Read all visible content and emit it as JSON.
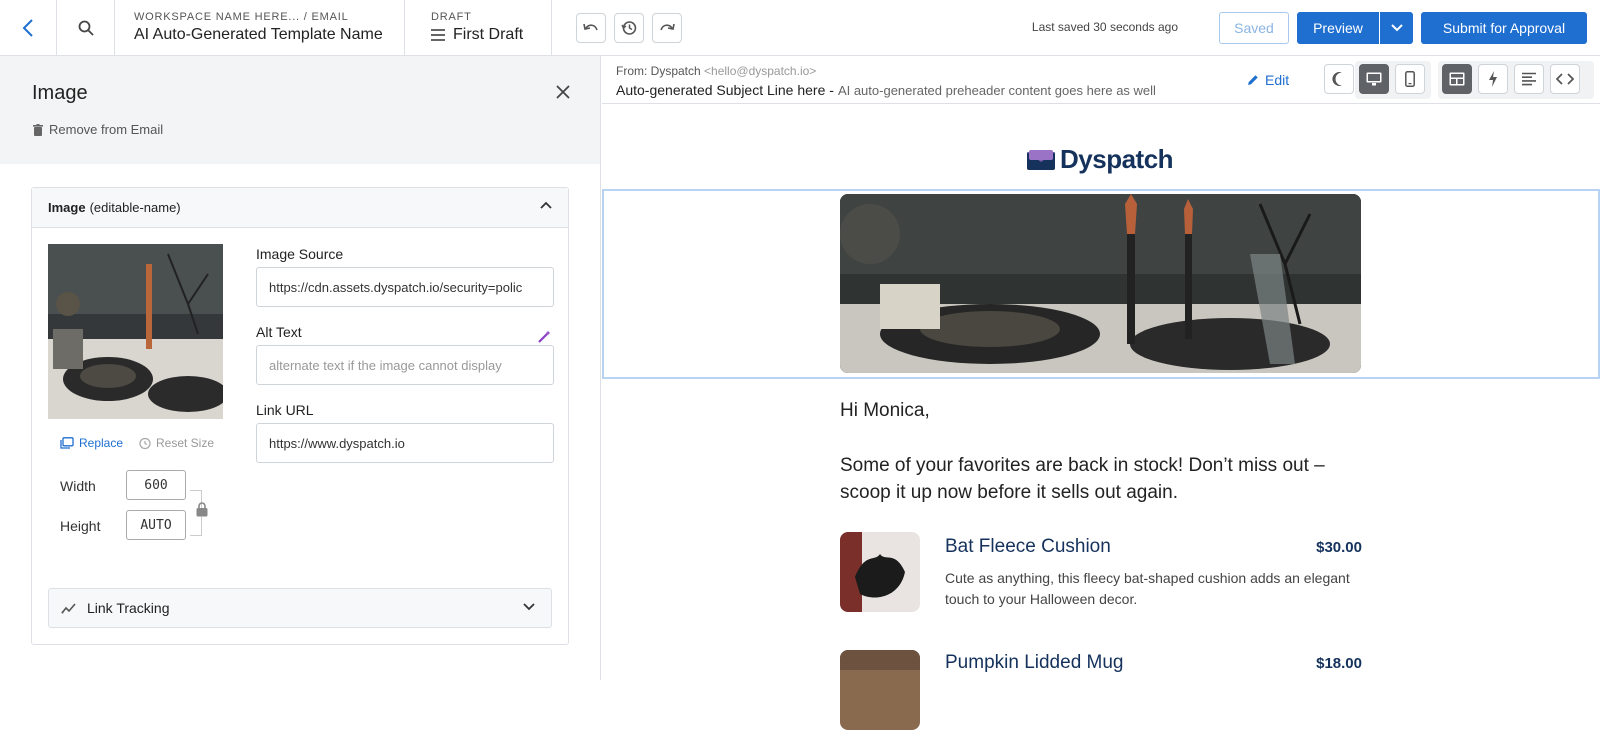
{
  "topbar": {
    "breadcrumb_small": "WORKSPACE NAME HERE... / EMAIL",
    "template_name": "AI Auto-Generated Template Name",
    "draft_small": "DRAFT",
    "draft_name": "First Draft",
    "last_saved": "Last saved 30 seconds ago",
    "saved_label": "Saved",
    "preview_label": "Preview",
    "submit_label": "Submit for Approval"
  },
  "panel": {
    "title": "Image",
    "remove_label": "Remove from Email",
    "card_title_bold": "Image",
    "card_title_rest": "(editable-name)",
    "replace_label": "Replace",
    "reset_size_label": "Reset Size",
    "width_label": "Width",
    "width_value": "600",
    "height_label": "Height",
    "height_value": "AUTO",
    "image_source_label": "Image Source",
    "image_source_value": "https://cdn.assets.dyspatch.io/security=polic",
    "alt_text_label": "Alt Text",
    "alt_text_placeholder": "alternate text if the image cannot display",
    "link_url_label": "Link URL",
    "link_url_value": "https://www.dyspatch.io",
    "link_tracking_label": "Link Tracking"
  },
  "preview_header": {
    "from_label": "From: Dyspatch",
    "from_address": "<hello@dyspatch.io>",
    "subject": "Auto-generated Subject Line here -",
    "preheader": "AI auto-generated preheader content goes here as well",
    "edit_label": "Edit"
  },
  "email": {
    "logo_text": "Dyspatch",
    "greeting": "Hi Monica,",
    "intro": "Some of your favorites are back in stock! Don’t miss out – scoop it up now before it sells out again.",
    "products": [
      {
        "name": "Bat Fleece Cushion",
        "price": "$30.00",
        "description": "Cute as anything, this fleecy bat-shaped cushion adds an elegant touch to your Halloween decor."
      },
      {
        "name": "Pumpkin Lidded Mug",
        "price": "$18.00",
        "description": ""
      }
    ]
  },
  "colors": {
    "accent": "#1f6fd0",
    "brand_navy": "#15325c",
    "selection": "#b7d3f1"
  }
}
